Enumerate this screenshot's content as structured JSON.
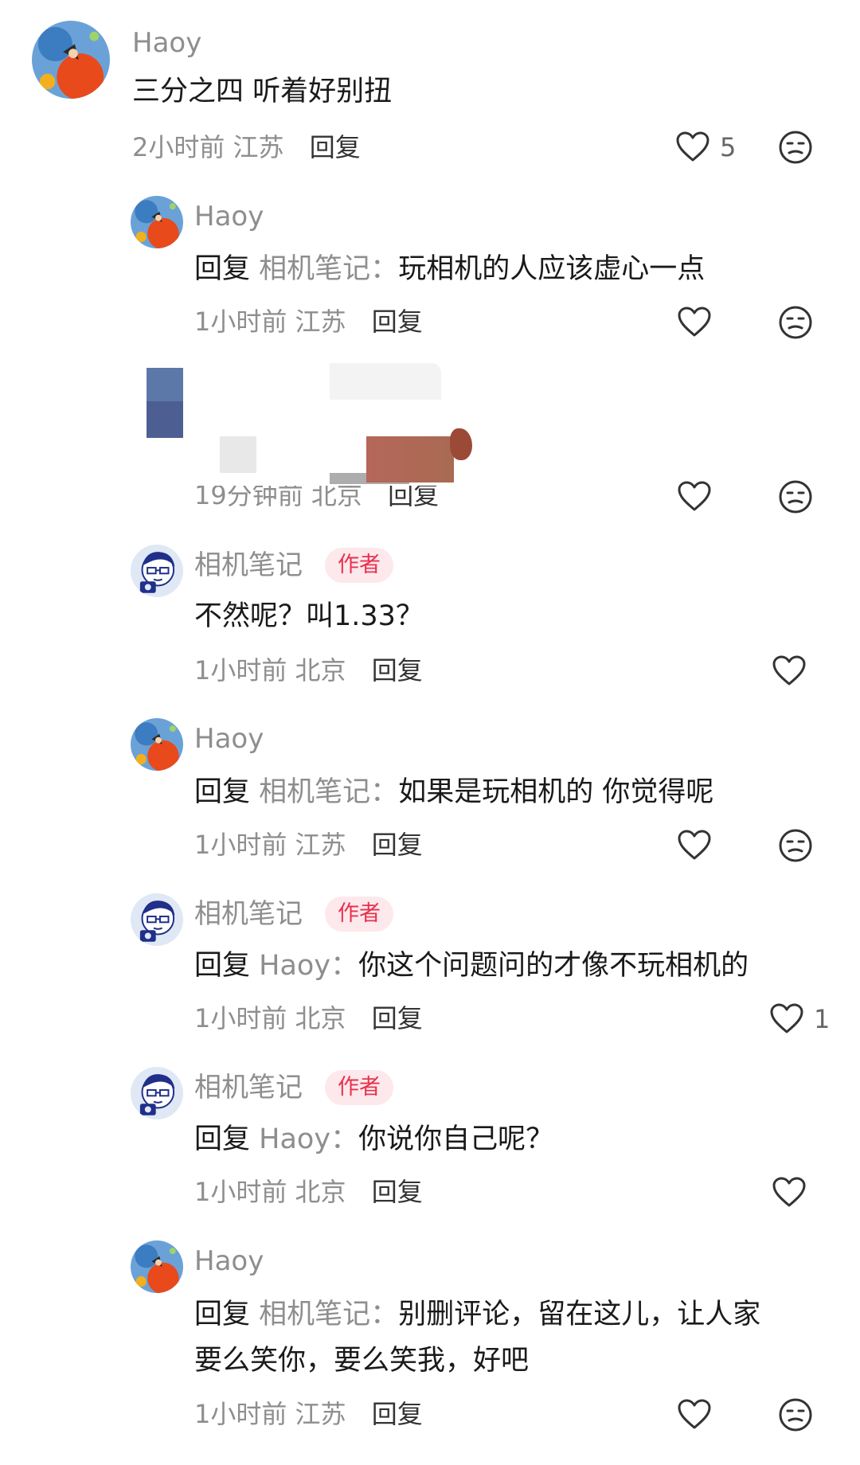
{
  "reply_label": "回复",
  "colon": "：",
  "top_comment": {
    "username": "Haoy",
    "text": "三分之四 听着好别扭",
    "time": "2小时前",
    "location": "江苏",
    "likes": "5"
  },
  "replies": [
    {
      "username": "Haoy",
      "reply_to": "相机笔记",
      "text": "玩相机的人应该虚心一点",
      "time": "1小时前",
      "location": "江苏"
    },
    {
      "time_partial": "19分钟前",
      "location": "北京"
    },
    {
      "username": "相机笔记",
      "badge": "作者",
      "text": "不然呢？叫1.33？",
      "time": "1小时前",
      "location": "北京"
    },
    {
      "username": "Haoy",
      "reply_to": "相机笔记",
      "text": "如果是玩相机的 你觉得呢",
      "time": "1小时前",
      "location": "江苏"
    },
    {
      "username": "相机笔记",
      "badge": "作者",
      "reply_to": "Haoy",
      "text": "你这个问题问的才像不玩相机的",
      "time": "1小时前",
      "location": "北京",
      "likes": "1"
    },
    {
      "username": "相机笔记",
      "badge": "作者",
      "reply_to": "Haoy",
      "text": "你说你自己呢？",
      "time": "1小时前",
      "location": "北京"
    },
    {
      "username": "Haoy",
      "reply_to": "相机笔记",
      "text_line1": "别删评论，留在这儿，让人家",
      "text_line2": "要么笑你，要么笑我，好吧",
      "time": "1小时前",
      "location": "江苏"
    }
  ],
  "colors": {
    "author_badge_bg": "#fde8ec",
    "author_badge_text": "#e8324f",
    "meta_gray": "#8e8e8e"
  }
}
